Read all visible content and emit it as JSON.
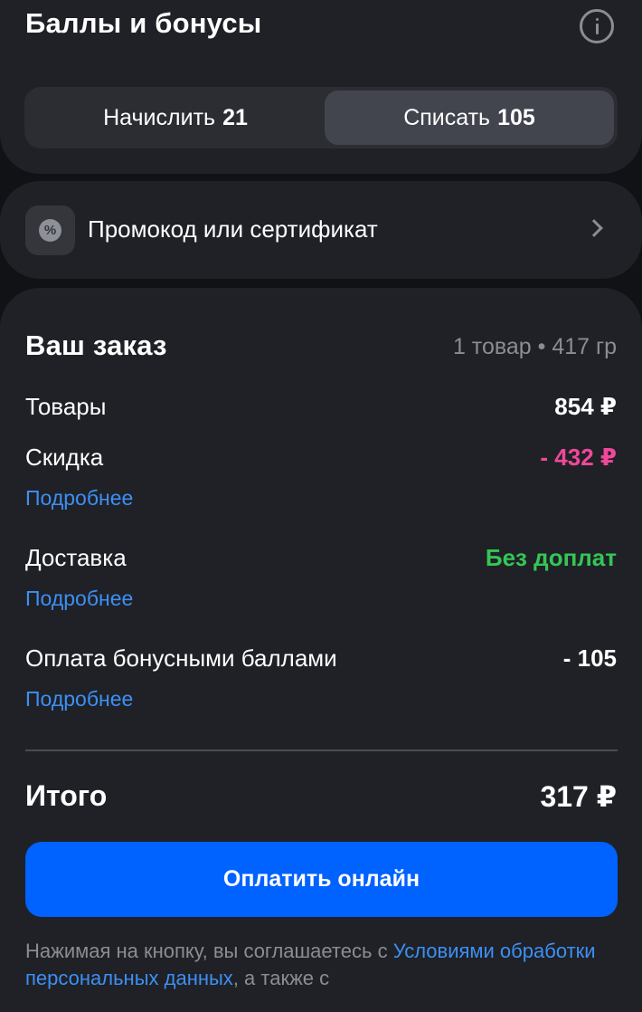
{
  "bonus": {
    "title": "Баллы и бонусы",
    "info_icon": "info-icon",
    "tabs": [
      {
        "label": "Начислить",
        "value": "21",
        "selected": false
      },
      {
        "label": "Списать",
        "value": "105",
        "selected": true
      }
    ]
  },
  "promo": {
    "icon": "discount-badge-icon",
    "label": "Промокод или сертификат"
  },
  "order": {
    "title": "Ваш заказ",
    "meta": "1 товар • 417 гр",
    "rows": [
      {
        "label": "Товары",
        "value": "854 ₽"
      },
      {
        "label": "Скидка",
        "value": "- 432 ₽",
        "link": "Подробнее"
      },
      {
        "label": "Доставка",
        "value": "Без доплат",
        "link": "Подробнее"
      },
      {
        "label": "Оплата бонусными баллами",
        "value": "- 105",
        "link": "Подробнее"
      }
    ],
    "total_label": "Итого",
    "total_value": "317 ₽",
    "pay_button": "Оплатить онлайн",
    "legal_prefix": "Нажимая на кнопку, вы соглашаетесь с ",
    "legal_link": "Условиями обработки персональных данных",
    "legal_suffix": ", а также с"
  },
  "colors": {
    "accent": "#0062ff",
    "link": "#3d8ff5",
    "discount": "#f0489a",
    "free": "#35c557"
  }
}
